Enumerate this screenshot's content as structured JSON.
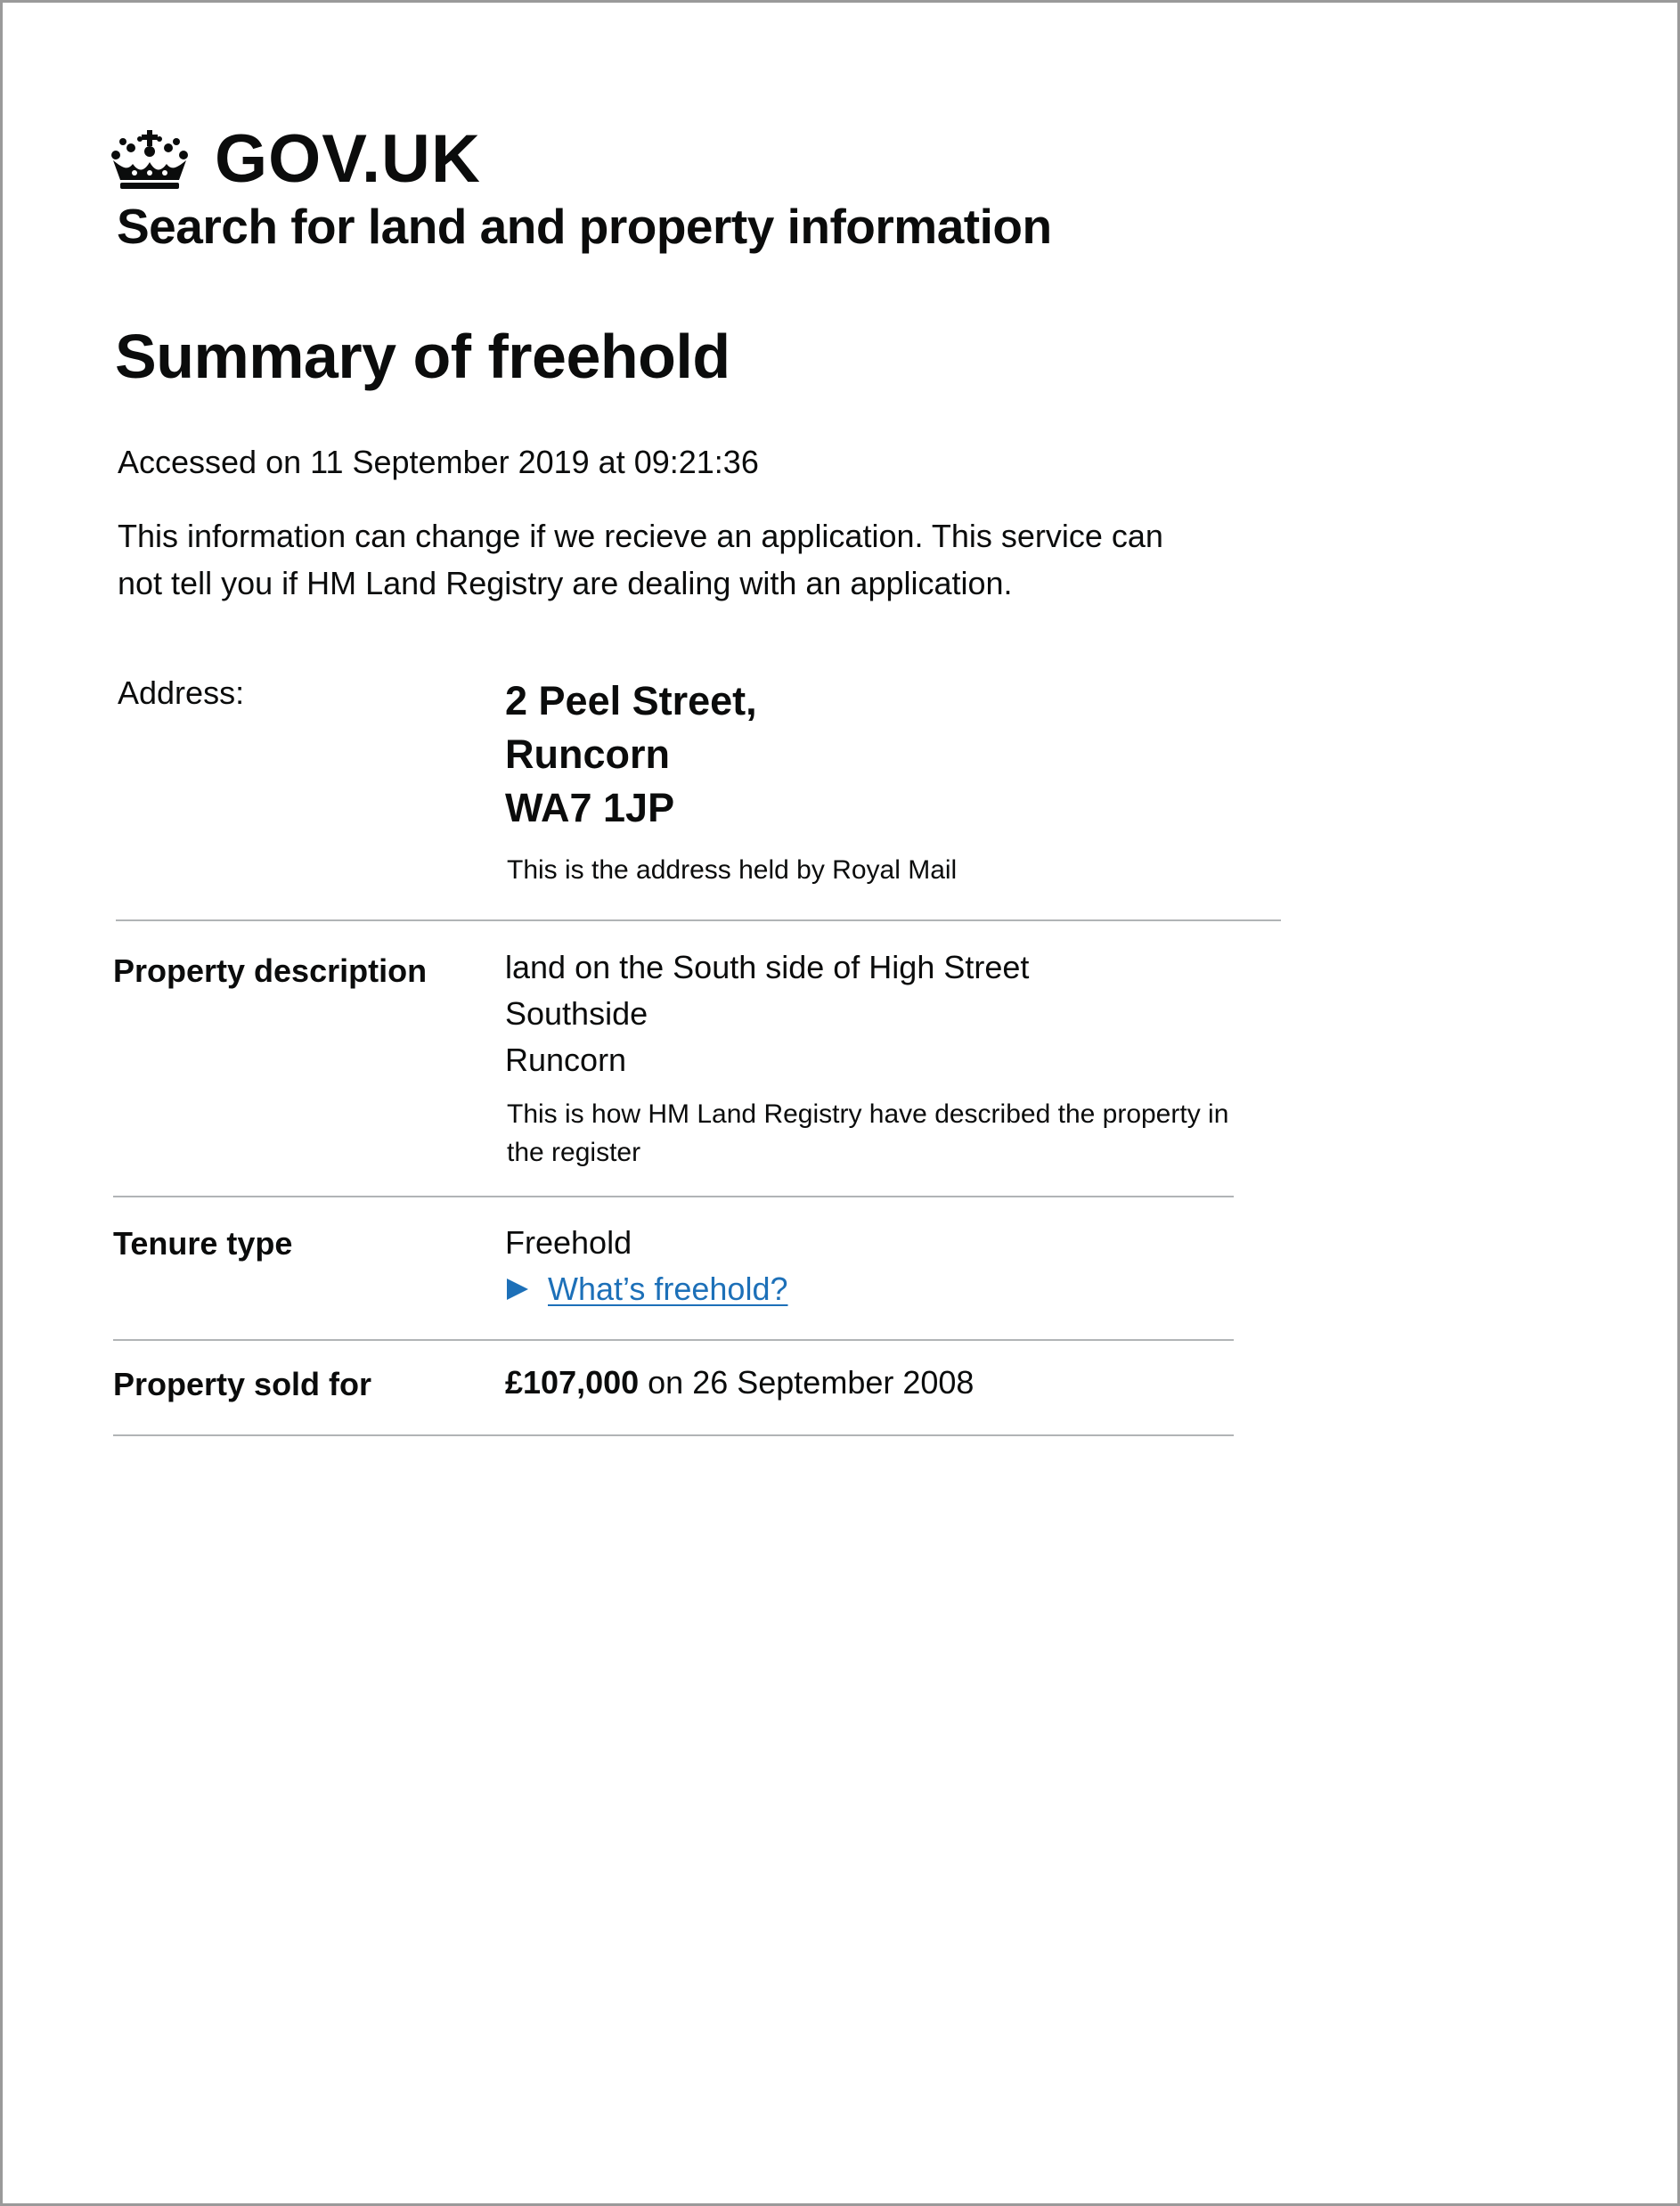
{
  "header": {
    "brand": "GOV.UK",
    "service_name": "Search for land and property information"
  },
  "page": {
    "title": "Summary of freehold",
    "accessed": "Accessed on 11 September 2019 at 09:21:36",
    "notice": "This information can change if we recieve an application. This service can not tell you if HM Land Registry are dealing with an application."
  },
  "summary": {
    "address": {
      "label": "Address:",
      "lines": [
        "2 Peel Street,",
        "Runcorn",
        "WA7 1JP"
      ],
      "hint": "This is the address held by Royal Mail"
    },
    "description": {
      "label": "Property description",
      "lines": [
        "land on the South side of High Street",
        "Southside",
        "Runcorn"
      ],
      "hint": "This is how HM Land Registry have described the property in the register"
    },
    "tenure": {
      "label": "Tenure type",
      "value": "Freehold",
      "link_text": "What’s freehold?"
    },
    "sold": {
      "label": "Property sold for",
      "price": "£107,000",
      "date_text": " on 26 September 2008"
    }
  },
  "colors": {
    "text": "#0b0c0c",
    "link": "#1d70b8",
    "rule": "#b1b4b6"
  },
  "icons": {
    "brand_logo": "crown-icon",
    "details_toggle": "triangle-right-icon"
  }
}
